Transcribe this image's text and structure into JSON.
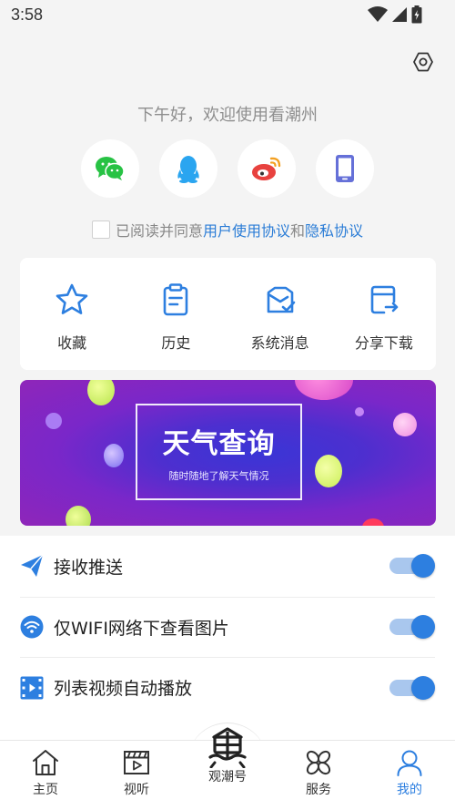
{
  "status_bar": {
    "time": "3:58"
  },
  "greeting": "下午好，欢迎使用看潮州",
  "login": {
    "options": [
      {
        "name": "wechat-icon",
        "color": "#27c244"
      },
      {
        "name": "qq-icon",
        "color": "#2aa5f0"
      },
      {
        "name": "weibo-icon",
        "color": "#e8423f"
      },
      {
        "name": "phone-icon",
        "color": "#6570d8"
      }
    ]
  },
  "agreement": {
    "prefix": "已阅读并同意",
    "user_agreement": "用户使用协议",
    "conjunction": "和",
    "privacy_policy": "隐私协议"
  },
  "quick_actions": [
    {
      "label": "收藏",
      "icon": "star-icon"
    },
    {
      "label": "历史",
      "icon": "clipboard-icon"
    },
    {
      "label": "系统消息",
      "icon": "message-check-icon"
    },
    {
      "label": "分享下载",
      "icon": "share-download-icon"
    }
  ],
  "banner": {
    "title": "天气查询",
    "subtitle": "随时随地了解天气情况"
  },
  "settings": [
    {
      "label": "接收推送",
      "icon": "send-icon",
      "enabled": true
    },
    {
      "label": "仅WIFI网络下查看图片",
      "icon": "wifi-icon",
      "enabled": true
    },
    {
      "label": "列表视频自动播放",
      "icon": "video-icon",
      "enabled": true
    }
  ],
  "tabs": [
    {
      "label": "主页",
      "icon": "home-icon",
      "active": false
    },
    {
      "label": "视听",
      "icon": "clapperboard-icon",
      "active": false
    },
    {
      "label": "观潮号",
      "icon": "guanchao-logo-icon",
      "active": false
    },
    {
      "label": "服务",
      "icon": "services-icon",
      "active": false
    },
    {
      "label": "我的",
      "icon": "profile-icon",
      "active": true
    }
  ],
  "colors": {
    "accent": "#2d7fe0",
    "link": "#2a7cd6",
    "background": "#f4f4f4"
  }
}
